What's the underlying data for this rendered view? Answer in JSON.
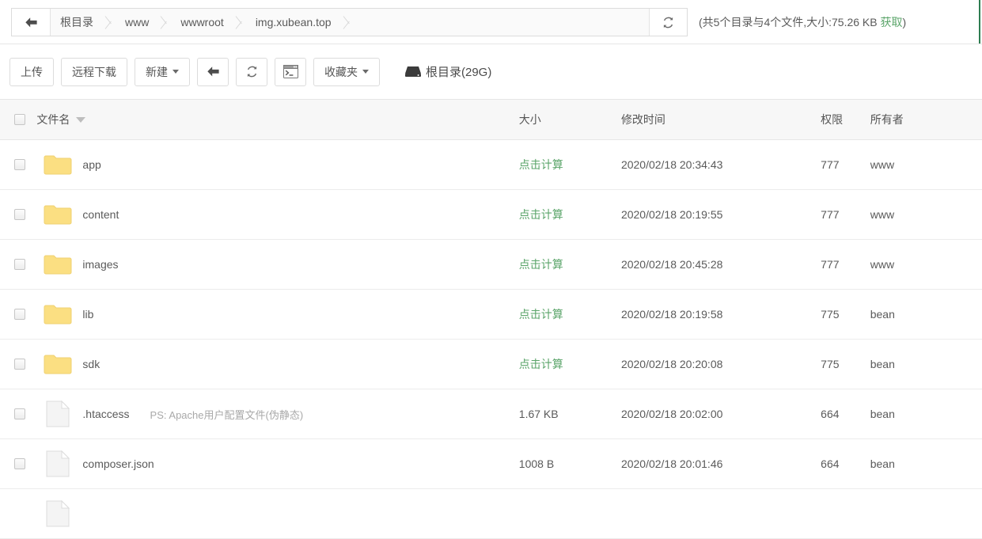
{
  "breadcrumb": {
    "back_icon": "arrow-left-icon",
    "items": [
      "根目录",
      "www",
      "wwwroot",
      "img.xubean.top"
    ],
    "refresh_icon": "refresh-icon",
    "stats_prefix": "(共5个目录与4个文件,大小:75.26 KB ",
    "stats_link": "获取",
    "stats_suffix": ")",
    "accent_color": "#2e7d51"
  },
  "toolbar": {
    "upload_label": "上传",
    "remote_download_label": "远程下载",
    "new_label": "新建",
    "back_icon": "arrow-left-icon",
    "refresh_icon": "refresh-icon",
    "terminal_icon": "terminal-icon",
    "favorites_label": "收藏夹",
    "disk_icon": "hard-drive-icon",
    "disk_label": "根目录(29G)"
  },
  "table": {
    "headers": {
      "name": "文件名",
      "size": "大小",
      "mtime": "修改时间",
      "perm": "权限",
      "owner": "所有者"
    },
    "size_calc_label": "点击计算",
    "size_calc_color": "#5aa469",
    "rows": [
      {
        "type": "folder",
        "name": "app",
        "note": "",
        "size": "点击计算",
        "size_is_calc": true,
        "mtime": "2020/02/18 20:34:43",
        "perm": "777",
        "owner": "www"
      },
      {
        "type": "folder",
        "name": "content",
        "note": "",
        "size": "点击计算",
        "size_is_calc": true,
        "mtime": "2020/02/18 20:19:55",
        "perm": "777",
        "owner": "www"
      },
      {
        "type": "folder",
        "name": "images",
        "note": "",
        "size": "点击计算",
        "size_is_calc": true,
        "mtime": "2020/02/18 20:45:28",
        "perm": "777",
        "owner": "www"
      },
      {
        "type": "folder",
        "name": "lib",
        "note": "",
        "size": "点击计算",
        "size_is_calc": true,
        "mtime": "2020/02/18 20:19:58",
        "perm": "775",
        "owner": "bean"
      },
      {
        "type": "folder",
        "name": "sdk",
        "note": "",
        "size": "点击计算",
        "size_is_calc": true,
        "mtime": "2020/02/18 20:20:08",
        "perm": "775",
        "owner": "bean"
      },
      {
        "type": "file",
        "name": ".htaccess",
        "note": "PS: Apache用户配置文件(伪静态)",
        "size": "1.67 KB",
        "size_is_calc": false,
        "mtime": "2020/02/18 20:02:00",
        "perm": "664",
        "owner": "bean"
      },
      {
        "type": "file",
        "name": "composer.json",
        "note": "",
        "size": "1008 B",
        "size_is_calc": false,
        "mtime": "2020/02/18 20:01:46",
        "perm": "664",
        "owner": "bean"
      },
      {
        "type": "file",
        "name": "",
        "note": "",
        "size": "",
        "size_is_calc": false,
        "mtime": "",
        "perm": "",
        "owner": ""
      }
    ]
  },
  "colors": {
    "folder": "#fbdf82",
    "folder_border": "#efd071",
    "file": "#f4f4f4",
    "green": "#5aa469"
  }
}
